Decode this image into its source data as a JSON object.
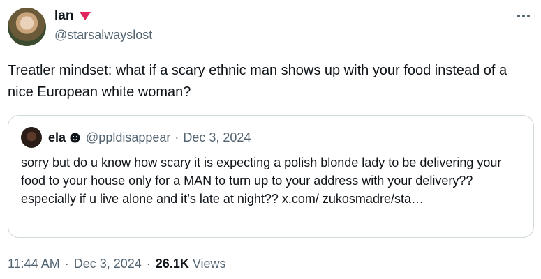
{
  "author": {
    "display_name": "Ian",
    "handle": "@starsalwayslost",
    "badge_icon": "red-triangle-icon",
    "badge_color": "#e0245e"
  },
  "tweet": {
    "text": "Treatler mindset: what if a scary ethnic man shows up with your food instead of a nice European white woman?"
  },
  "quote": {
    "display_name": "ela",
    "badge_icon": "smiley-icon",
    "handle": "@ppldisappear",
    "separator": "·",
    "date": "Dec 3, 2024",
    "text": "sorry but do u know how scary it is expecting a polish blonde lady to be delivering your food to your house only for a MAN to turn up to your address with your delivery?? especially if u live alone and it’s late at night?? x.com/ zukosmadre/sta…"
  },
  "meta": {
    "time": "11:44 AM",
    "separator": "·",
    "date": "Dec 3, 2024",
    "views_count": "26.1K",
    "views_label": "Views"
  },
  "colors": {
    "text": "#0f1419",
    "secondary": "#536471",
    "border": "#cfd9de"
  }
}
